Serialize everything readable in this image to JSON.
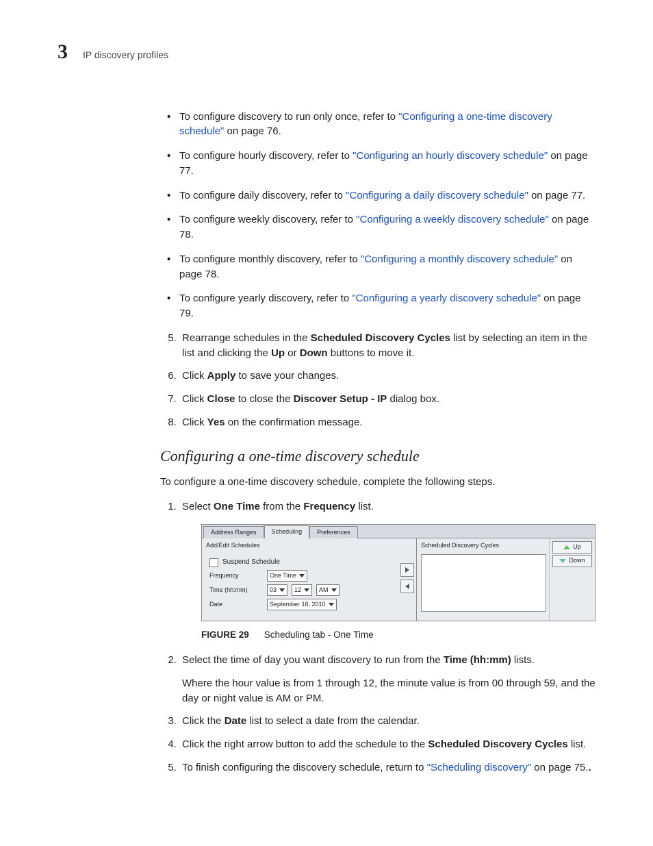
{
  "header": {
    "chapter_number": "3",
    "chapter_title": "IP discovery profiles"
  },
  "intro_bullets": [
    {
      "pre": "To configure discovery to run only once, refer to ",
      "link": "\"Configuring a one-time discovery schedule\"",
      "post": " on page 76."
    },
    {
      "pre": "To configure hourly discovery, refer to ",
      "link": "\"Configuring an hourly discovery schedule\"",
      "post": " on page 77."
    },
    {
      "pre": "To configure daily discovery, refer to ",
      "link": "\"Configuring a daily discovery schedule\"",
      "post": " on page 77."
    },
    {
      "pre": "To configure weekly discovery, refer to ",
      "link": "\"Configuring a weekly discovery schedule\"",
      "post": " on page 78."
    },
    {
      "pre": "To configure monthly discovery, refer to ",
      "link": "\"Configuring a monthly discovery schedule\"",
      "post": " on page 78."
    },
    {
      "pre": "To configure yearly discovery, refer to ",
      "link": "\"Configuring a yearly discovery schedule\"",
      "post": " on page 79."
    }
  ],
  "steps_a": {
    "s5": {
      "t1": "Rearrange schedules in the ",
      "b1": "Scheduled Discovery Cycles",
      "t2": " list by selecting an item in the list and clicking the ",
      "b2": "Up",
      "t3": " or ",
      "b3": "Down",
      "t4": " buttons to move it."
    },
    "s6": {
      "t1": "Click ",
      "b1": "Apply",
      "t2": " to save your changes."
    },
    "s7": {
      "t1": "Click ",
      "b1": "Close",
      "t2": " to close the ",
      "b2": "Discover Setup - IP",
      "t3": " dialog box."
    },
    "s8": {
      "t1": "Click ",
      "b1": "Yes",
      "t2": " on the confirmation message."
    }
  },
  "section": {
    "heading": "Configuring a one-time discovery schedule",
    "intro": "To configure a one-time discovery schedule, complete the following steps."
  },
  "steps_b": {
    "s1": {
      "t1": "Select ",
      "b1": "One Time",
      "t2": " from the ",
      "b2": "Frequency",
      "t3": " list."
    },
    "s2": {
      "t1": "Select the time of day you want discovery to run from the ",
      "b1": "Time (hh:mm)",
      "t2": " lists.",
      "sub": "Where the hour value is from 1 through 12, the minute value is from 00 through 59, and the day or night value is AM or PM."
    },
    "s3": {
      "t1": "Click the ",
      "b1": "Date",
      "t2": " list to select a date from the calendar."
    },
    "s4": {
      "t1": "Click the right arrow button to add the schedule to the ",
      "b1": "Scheduled Discovery Cycles",
      "t2": " list."
    },
    "s5": {
      "t1": "To finish configuring the discovery schedule, return to ",
      "link": "\"Scheduling discovery\"",
      "t2": " on page 75."
    }
  },
  "figure": {
    "tabs": {
      "t1": "Address Ranges",
      "t2": "Scheduling",
      "t3": "Preferences"
    },
    "left_title": "Add/Edit Schedules",
    "suspend": "Suspend Schedule",
    "labels": {
      "freq": "Frequency",
      "time": "Time (hh:mm)",
      "date": "Date"
    },
    "values": {
      "freq": "One Time",
      "hh": "03",
      "mm": "12",
      "ampm": "AM",
      "date": "September 16, 2010"
    },
    "right_title": "Scheduled Discovery Cycles",
    "btns": {
      "up": "Up",
      "down": "Down"
    },
    "caption_num": "FIGURE 29",
    "caption_text": "Scheduling tab - One Time"
  }
}
